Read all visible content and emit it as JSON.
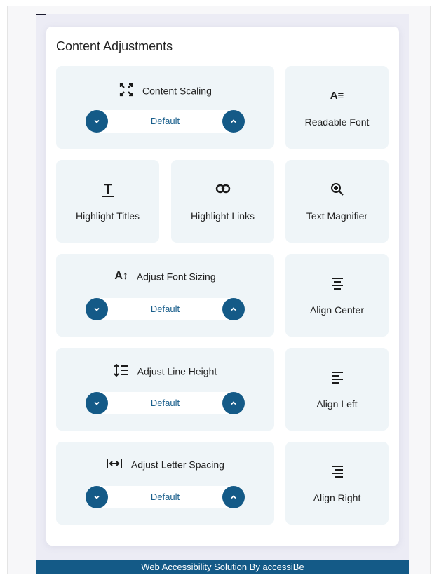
{
  "section": {
    "title": "Content Adjustments"
  },
  "tiles": {
    "content_scaling": {
      "label": "Content Scaling",
      "icon": "expand-icon",
      "value": "Default"
    },
    "readable_font": {
      "label": "Readable Font",
      "icon": "readable-font-icon"
    },
    "highlight_titles": {
      "label": "Highlight Titles",
      "icon": "title-icon"
    },
    "highlight_links": {
      "label": "Highlight Links",
      "icon": "link-icon"
    },
    "text_magnifier": {
      "label": "Text Magnifier",
      "icon": "zoom-in-icon"
    },
    "adjust_font_sizing": {
      "label": "Adjust Font Sizing",
      "icon": "font-size-icon",
      "value": "Default"
    },
    "align_center": {
      "label": "Align Center",
      "icon": "align-center-icon"
    },
    "adjust_line_height": {
      "label": "Adjust Line Height",
      "icon": "line-height-icon",
      "value": "Default"
    },
    "align_left": {
      "label": "Align Left",
      "icon": "align-left-icon"
    },
    "adjust_letter_spacing": {
      "label": "Adjust Letter Spacing",
      "icon": "letter-spacing-icon",
      "value": "Default"
    },
    "align_right": {
      "label": "Align Right",
      "icon": "align-right-icon"
    }
  },
  "readable_font_glyph": "A≡",
  "font_size_glyph": "A↕",
  "footer": {
    "text": "Web Accessibility Solution By accessiBe"
  },
  "colors": {
    "accent": "#145a87",
    "tile_bg": "#eff5f8",
    "value_text": "#1a5f8c"
  }
}
